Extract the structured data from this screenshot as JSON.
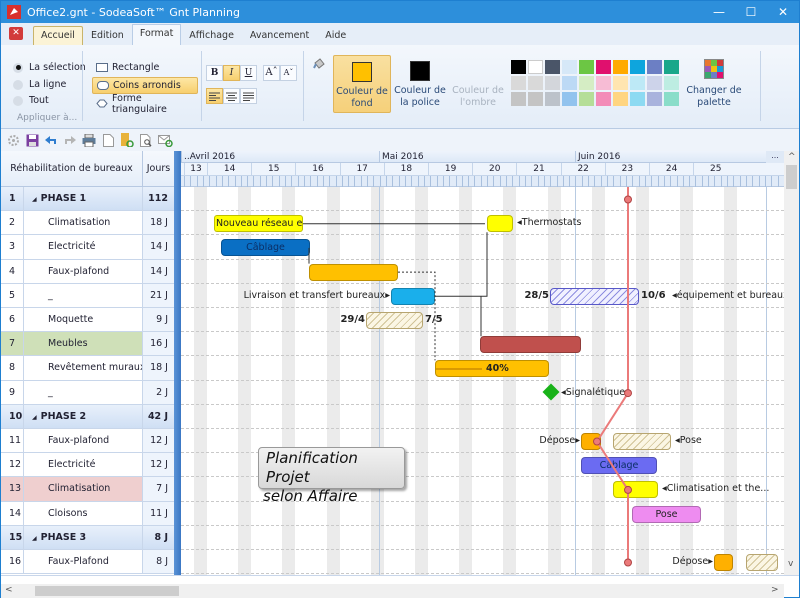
{
  "window": {
    "title": "Office2.gnt - SodeaSoft™ Gnt Planning",
    "controls": [
      "—",
      "☐",
      "✕"
    ]
  },
  "tabs": [
    {
      "label": "Accueil",
      "state": "highlighted"
    },
    {
      "label": "Edition",
      "state": "normal"
    },
    {
      "label": "Format",
      "state": "active"
    },
    {
      "label": "Affichage",
      "state": "normal"
    },
    {
      "label": "Avancement",
      "state": "normal"
    },
    {
      "label": "Aide",
      "state": "normal"
    }
  ],
  "ribbon": {
    "apply_group": {
      "options": [
        {
          "label": "La sélection",
          "checked": true
        },
        {
          "label": "La ligne",
          "checked": false
        },
        {
          "label": "Tout",
          "checked": false
        }
      ],
      "group_label": "Appliquer à..."
    },
    "shape_group": {
      "options": [
        {
          "label": "Rectangle",
          "icon": "rectangle-icon",
          "selected": false
        },
        {
          "label": "Coins arrondis",
          "icon": "rounded-rect-icon",
          "selected": true
        },
        {
          "label": "Forme triangulaire",
          "icon": "diamond-shape-icon",
          "selected": false
        }
      ]
    },
    "text_format": {
      "bold": "B",
      "italic": "I",
      "underline": "U",
      "grow": "Aˆ",
      "shrink": "Aˇ",
      "italic_active": true,
      "align_left_active": true
    },
    "color_buttons": [
      {
        "label": "Couleur de fond",
        "swatch": "#FFC000",
        "state": "active"
      },
      {
        "label": "Couleur de la police",
        "swatch": "#000000",
        "state": "normal"
      },
      {
        "label": "Couleur de l'ombre",
        "swatch": null,
        "state": "disabled"
      }
    ],
    "palette": [
      [
        "#000000",
        "#FFFFFF",
        "#4A5568",
        "#D6E8F8",
        "#6CC644",
        "#E0106E",
        "#FFAA00",
        "#0EA5DD",
        "#6C7FC4",
        "#19A78A"
      ],
      [
        "#D9D9D9",
        "#D9D9D9",
        "#D3D6DB",
        "#BCD9F5",
        "#D5EDC4",
        "#F7BCD5",
        "#FFE5B0",
        "#BDE9F6",
        "#CDD3EA",
        "#BDEDE2"
      ],
      [
        "#C4C4C4",
        "#C4C4C4",
        "#BCC2CA",
        "#92C3EE",
        "#B5DE98",
        "#F38CB8",
        "#FFD581",
        "#8DDAF2",
        "#A9B3DD",
        "#8ADDC9"
      ]
    ],
    "change_palette_label": "Changer de palette"
  },
  "toolbar": {
    "icons": [
      "settings-icon",
      "save-icon",
      "undo-icon",
      "redo-icon",
      "print-icon",
      "new-document-icon",
      "open-folder-icon",
      "print-preview-icon",
      "email-icon"
    ]
  },
  "grid": {
    "header_name": "Réhabilitation de bureaux",
    "header_days": "Jours",
    "rows": [
      {
        "num": "1",
        "name": "PHASE 1",
        "days": "112 J",
        "type": "phase",
        "collapse": "◢"
      },
      {
        "num": "2",
        "name": "Climatisation",
        "days": "18 J",
        "type": "task"
      },
      {
        "num": "3",
        "name": "Electricité",
        "days": "14 J",
        "type": "task"
      },
      {
        "num": "4",
        "name": "Faux-plafond",
        "days": "14 J",
        "type": "task"
      },
      {
        "num": "5",
        "name": "_",
        "days": "21 J",
        "type": "task"
      },
      {
        "num": "6",
        "name": "Moquette",
        "days": "9 J",
        "type": "task"
      },
      {
        "num": "7",
        "name": "Meubles",
        "days": "16 J",
        "type": "task",
        "highlight": "#CFE0B8"
      },
      {
        "num": "8",
        "name": "Revêtement muraux",
        "days": "18 J",
        "type": "task"
      },
      {
        "num": "9",
        "name": "_",
        "days": "2 J",
        "type": "task"
      },
      {
        "num": "10",
        "name": "PHASE 2",
        "days": "42 J",
        "type": "phase",
        "collapse": "◢"
      },
      {
        "num": "11",
        "name": "Faux-plafond",
        "days": "12 J",
        "type": "task"
      },
      {
        "num": "12",
        "name": "Electricité",
        "days": "12 J",
        "type": "task"
      },
      {
        "num": "13",
        "name": "Climatisation",
        "days": "7 J",
        "type": "task",
        "highlight": "#EFCFCF"
      },
      {
        "num": "14",
        "name": "Cloisons",
        "days": "11 J",
        "type": "task"
      },
      {
        "num": "15",
        "name": "PHASE 3",
        "days": "8 J",
        "type": "phase",
        "collapse": "◢"
      },
      {
        "num": "16",
        "name": "Faux-Plafond",
        "days": "8 J",
        "type": "task"
      }
    ]
  },
  "gantt": {
    "months": [
      "..Avril 2016",
      "Mai 2016",
      "Juin 2016"
    ],
    "more": "...",
    "weeks": [
      "13",
      "14",
      "15",
      "16",
      "17",
      "18",
      "19",
      "20",
      "21",
      "22",
      "23",
      "24",
      "25"
    ],
    "bars": [
      {
        "row": 2,
        "label": "Nouveau réseau e...",
        "color": "#FFFF00"
      },
      {
        "row": 2,
        "label": "",
        "color": "#FFFF00",
        "side_label": "Thermostats"
      },
      {
        "row": 3,
        "label": "Câblage",
        "color": "#0A6FC4"
      },
      {
        "row": 4,
        "label": "",
        "color": "#FFC000"
      },
      {
        "row": 5,
        "label": "",
        "color": "#1AAFEB",
        "side_label": "Livraison et transfert bureaux"
      },
      {
        "row": 5,
        "label": "",
        "style": "hatched-blue",
        "start_label": "28/5",
        "end_label": "10/6",
        "side_label": "équipement et bureaux"
      },
      {
        "row": 6,
        "label": "",
        "style": "hatched",
        "start_label": "29/4",
        "end_label": "7/5"
      },
      {
        "row": 7,
        "label": "",
        "color": "#C0504D"
      },
      {
        "row": 8,
        "label": "40%",
        "color": "#FFC000",
        "progress": 0.4
      },
      {
        "row": 9,
        "type": "milestone",
        "color": "#19B219",
        "side_label": "Signalétique"
      },
      {
        "row": 11,
        "label": "",
        "color": "#FFB000",
        "side_label": "Dépose"
      },
      {
        "row": 11,
        "label": "",
        "style": "hatched",
        "side_label": "Pose"
      },
      {
        "row": 12,
        "label": "Câblage",
        "color": "#6B6BF2"
      },
      {
        "row": 13,
        "label": "",
        "color": "#FFFF00",
        "side_label": "Climatisation et the..."
      },
      {
        "row": 14,
        "label": "Pose",
        "color": "#EE8CF0"
      },
      {
        "row": 16,
        "label": "",
        "color": "#FFB000",
        "side_label": "Dépose"
      },
      {
        "row": 16,
        "label": "",
        "style": "hatched"
      }
    ],
    "progress_line_color": "#EB7A7A",
    "note": {
      "line1": "Planification Projet",
      "line2": "selon Affaire"
    }
  }
}
